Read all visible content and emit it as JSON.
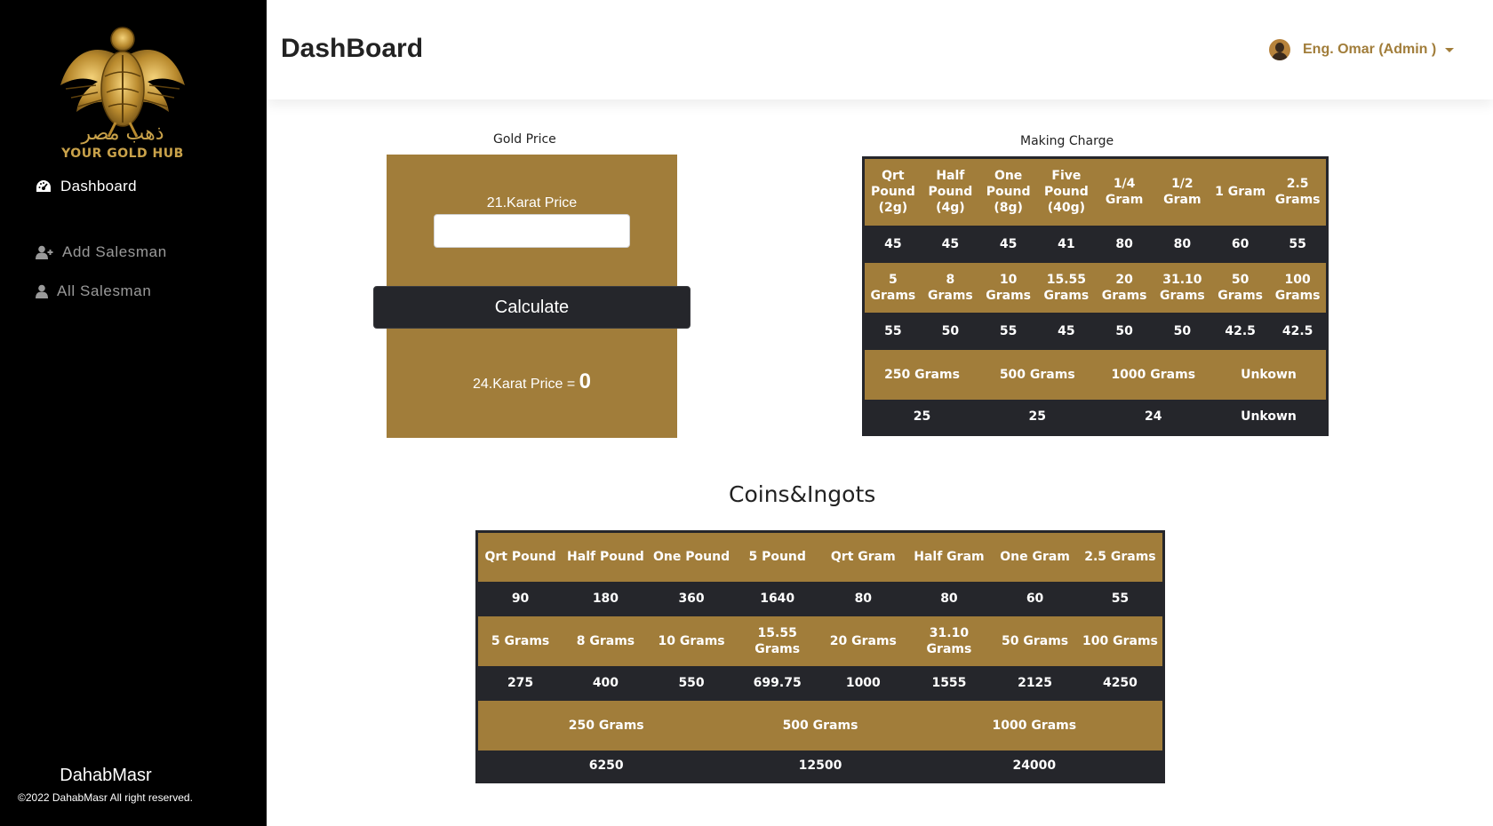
{
  "sidebar": {
    "logo_ar": "ذهب مصر",
    "logo_en": "YOUR GOLD HUB",
    "items": [
      {
        "label": "Dashboard",
        "icon": "gauge-icon"
      },
      {
        "label": "Add Salesman",
        "icon": "user-plus-icon"
      },
      {
        "label": "All Salesman",
        "icon": "user-icon"
      }
    ],
    "footer_brand": "DahabMasr",
    "copyright": "©2022 DahabMasr All right reserved."
  },
  "header": {
    "title": "DashBoard",
    "user_name": "Eng. Omar (Admin )"
  },
  "gold_price": {
    "heading": "Gold Price",
    "karat21_label": "21.Karat Price",
    "input_value": "",
    "calculate_label": "Calculate",
    "karat24_label": "24.Karat Price =",
    "karat24_value": "0"
  },
  "making_charge": {
    "heading": "Making Charge",
    "row1_headers": [
      "Qrt Pound (2g)",
      "Half Pound (4g)",
      "One Pound (8g)",
      "Five Pound (40g)",
      "1/4 Gram",
      "1/2 Gram",
      "1 Gram",
      "2.5 Grams"
    ],
    "row1_values": [
      "45",
      "45",
      "45",
      "41",
      "80",
      "80",
      "60",
      "55"
    ],
    "row2_headers": [
      "5 Grams",
      "8 Grams",
      "10 Grams",
      "15.55 Grams",
      "20 Grams",
      "31.10 Grams",
      "50 Grams",
      "100 Grams"
    ],
    "row2_values": [
      "55",
      "50",
      "55",
      "45",
      "50",
      "50",
      "42.5",
      "42.5"
    ],
    "row3_headers": [
      "250 Grams",
      "500 Grams",
      "1000 Grams",
      "Unkown"
    ],
    "row3_values": [
      "25",
      "25",
      "24",
      "Unkown"
    ]
  },
  "coins": {
    "heading": "Coins&Ingots",
    "row1_headers": [
      "Qrt Pound",
      "Half Pound",
      "One Pound",
      "5 Pound",
      "Qrt Gram",
      "Half Gram",
      "One Gram",
      "2.5 Grams"
    ],
    "row1_values": [
      "90",
      "180",
      "360",
      "1640",
      "80",
      "80",
      "60",
      "55"
    ],
    "row2_headers": [
      "5 Grams",
      "8 Grams",
      "10 Grams",
      "15.55 Grams",
      "20 Grams",
      "31.10 Grams",
      "50 Grams",
      "100 Grams"
    ],
    "row2_values": [
      "275",
      "400",
      "550",
      "699.75",
      "1000",
      "1555",
      "2125",
      "4250"
    ],
    "row3_headers": [
      "250 Grams",
      "500 Grams",
      "1000 Grams"
    ],
    "row3_values": [
      "6250",
      "12500",
      "24000"
    ]
  },
  "colors": {
    "gold": "#a17d3a",
    "dark": "#25262b",
    "sidebar": "#000000"
  }
}
